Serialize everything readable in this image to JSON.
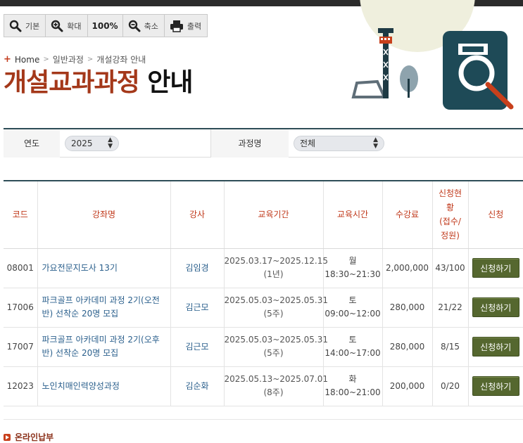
{
  "toolbar": {
    "items": [
      {
        "label": "기본",
        "icon": "magnifier-icon"
      },
      {
        "label": "확대",
        "icon": "zoom-in-icon"
      },
      {
        "label": "100%",
        "icon": ""
      },
      {
        "label": "축소",
        "icon": "zoom-out-icon"
      },
      {
        "label": "출력",
        "icon": "printer-icon"
      }
    ]
  },
  "breadcrumb": {
    "items": [
      "Home",
      "일반과정",
      "개설강좌 안내"
    ]
  },
  "title": {
    "accent": "개설교과과정",
    "rest": "안내"
  },
  "filter": {
    "year_label": "연도",
    "year_value": "2025",
    "course_label": "과정명",
    "course_value": "전체"
  },
  "table": {
    "headers": {
      "code": "코드",
      "name": "강좌명",
      "teacher": "강사",
      "period": "교육기간",
      "time": "교육시간",
      "fee": "수강료",
      "status_1": "신청현",
      "status_2": "황",
      "status_3": "(접수/",
      "status_4": "정원)",
      "apply": "신청"
    },
    "rows": [
      {
        "code": "08001",
        "name": "가요전문지도사 13기",
        "teacher": "김임경",
        "period": "2025.03.17~2025.12.15",
        "duration": "(1년)",
        "day": "월",
        "time": "18:30~21:30",
        "fee": "2,000,000",
        "status": "43/100",
        "apply": "신청하기"
      },
      {
        "code": "17006",
        "name": "파크골프 아카데미 과정 2기(오전반) 선착순 20명 모집",
        "teacher": "김근모",
        "period": "2025.05.03~2025.05.31",
        "duration": "(5주)",
        "day": "토",
        "time": "09:00~12:00",
        "fee": "280,000",
        "status": "21/22",
        "apply": "신청하기"
      },
      {
        "code": "17007",
        "name": "파크골프 아카데미 과정 2기(오후반) 선착순 20명 모집",
        "teacher": "김근모",
        "period": "2025.05.03~2025.05.31",
        "duration": "(5주)",
        "day": "토",
        "time": "14:00~17:00",
        "fee": "280,000",
        "status": "8/15",
        "apply": "신청하기"
      },
      {
        "code": "12023",
        "name": "노인치매인력양성과정",
        "teacher": "김순화",
        "period": "2025.05.13~2025.07.01",
        "duration": "(8주)",
        "day": "화",
        "time": "18:00~21:00",
        "fee": "200,000",
        "status": "0/20",
        "apply": "신청하기"
      }
    ]
  },
  "footer": {
    "online_payment": "온라인납부"
  },
  "colors": {
    "accent": "#a4381a",
    "header_text": "#c0391b",
    "button": "#55672f",
    "border": "#2e4d57"
  }
}
